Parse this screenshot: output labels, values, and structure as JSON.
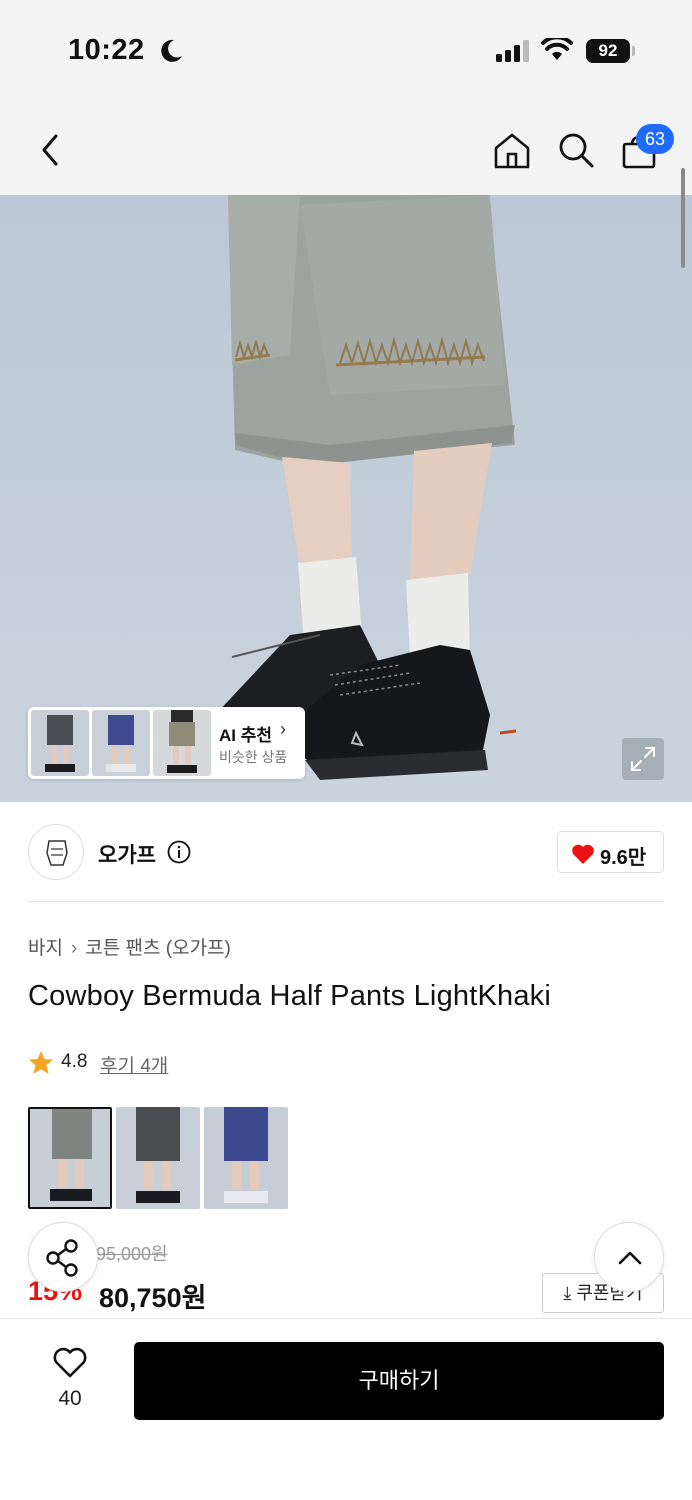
{
  "status_bar": {
    "time": "10:22",
    "battery": "92"
  },
  "nav": {
    "cart_count": "63"
  },
  "recommend_card": {
    "title": "AI 추천",
    "subtitle": "비슷한 상품"
  },
  "brand": {
    "name": "오가프",
    "like_count": "9.6만"
  },
  "breadcrumb": {
    "category": "바지",
    "subcategory": "코튼 팬츠 (오가프)"
  },
  "product": {
    "title": "Cowboy Bermuda Half Pants LightKhaki",
    "rating": "4.8",
    "reviews_label": "후기 4개",
    "original_price": "95,000원",
    "discount": "15%",
    "sale_price": "80,750원",
    "coupon_label": "⤓ 쿠폰받기"
  },
  "color_options": [
    {
      "name": "light-khaki",
      "color": "#8e9590"
    },
    {
      "name": "charcoal",
      "color": "#4a4d50"
    },
    {
      "name": "navy",
      "color": "#3b4a8f"
    }
  ],
  "bottom": {
    "wish_count": "40",
    "buy_label": "구매하기"
  },
  "colors": {
    "accent": "#1f6bff",
    "sale_red": "#e11",
    "heart_red": "#e11",
    "star": "#f5a623"
  }
}
